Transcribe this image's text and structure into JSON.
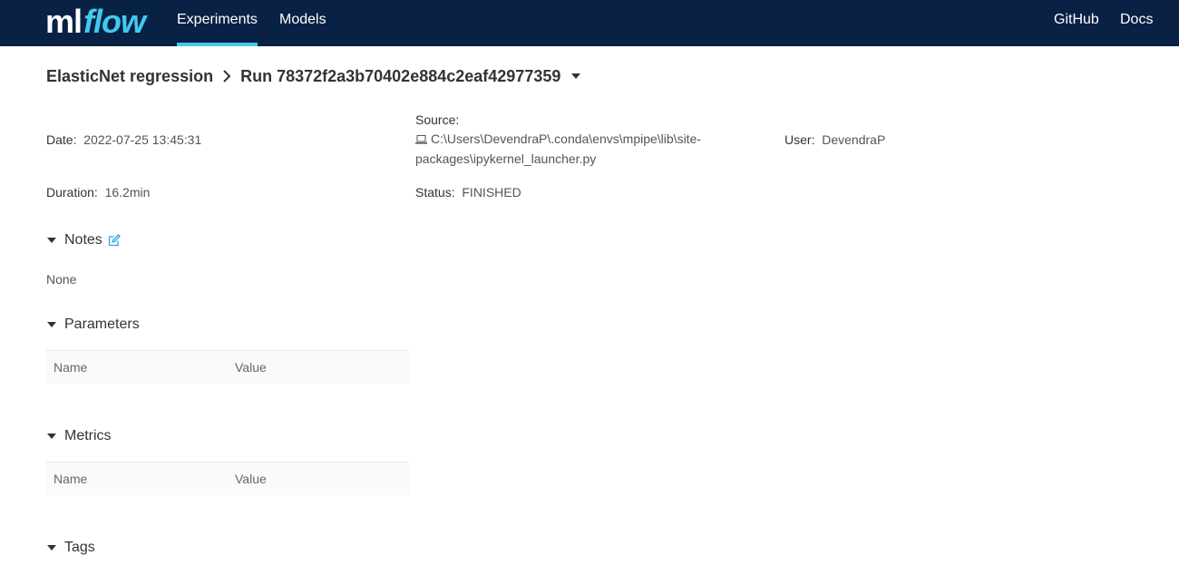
{
  "header": {
    "logo_ml": "ml",
    "logo_flow": "flow",
    "nav": [
      {
        "label": "Experiments",
        "active": true
      },
      {
        "label": "Models",
        "active": false
      }
    ],
    "links": [
      {
        "label": "GitHub"
      },
      {
        "label": "Docs"
      }
    ]
  },
  "breadcrumb": {
    "experiment": "ElasticNet regression",
    "run": "Run 78372f2a3b70402e884c2eaf42977359"
  },
  "run_meta": {
    "date_label": "Date",
    "date_value": "2022-07-25 13:45:31",
    "source_label": "Source",
    "source_value_line1": "C:\\Users\\DevendraP\\.conda\\envs\\mpipe\\lib\\site-",
    "source_value_line2": "packages\\ipykernel_launcher.py",
    "user_label": "User",
    "user_value": "DevendraP",
    "duration_label": "Duration",
    "duration_value": "16.2min",
    "status_label": "Status",
    "status_value": "FINISHED",
    "separator": ":"
  },
  "sections": {
    "notes": {
      "title": "Notes",
      "content": "None"
    },
    "parameters": {
      "title": "Parameters",
      "col_name": "Name",
      "col_value": "Value"
    },
    "metrics": {
      "title": "Metrics",
      "col_name": "Name",
      "col_value": "Value"
    },
    "tags": {
      "title": "Tags"
    }
  },
  "colors": {
    "header_bg": "#082144",
    "accent": "#43C9ED",
    "edit_icon": "#2BA7E0"
  },
  "icons": {
    "source": "laptop-icon",
    "notes_edit": "edit-icon",
    "section_toggle": "caret-down-icon",
    "breadcrumb_sep": "chevron-right-icon",
    "run_dropdown": "caret-down-icon"
  }
}
